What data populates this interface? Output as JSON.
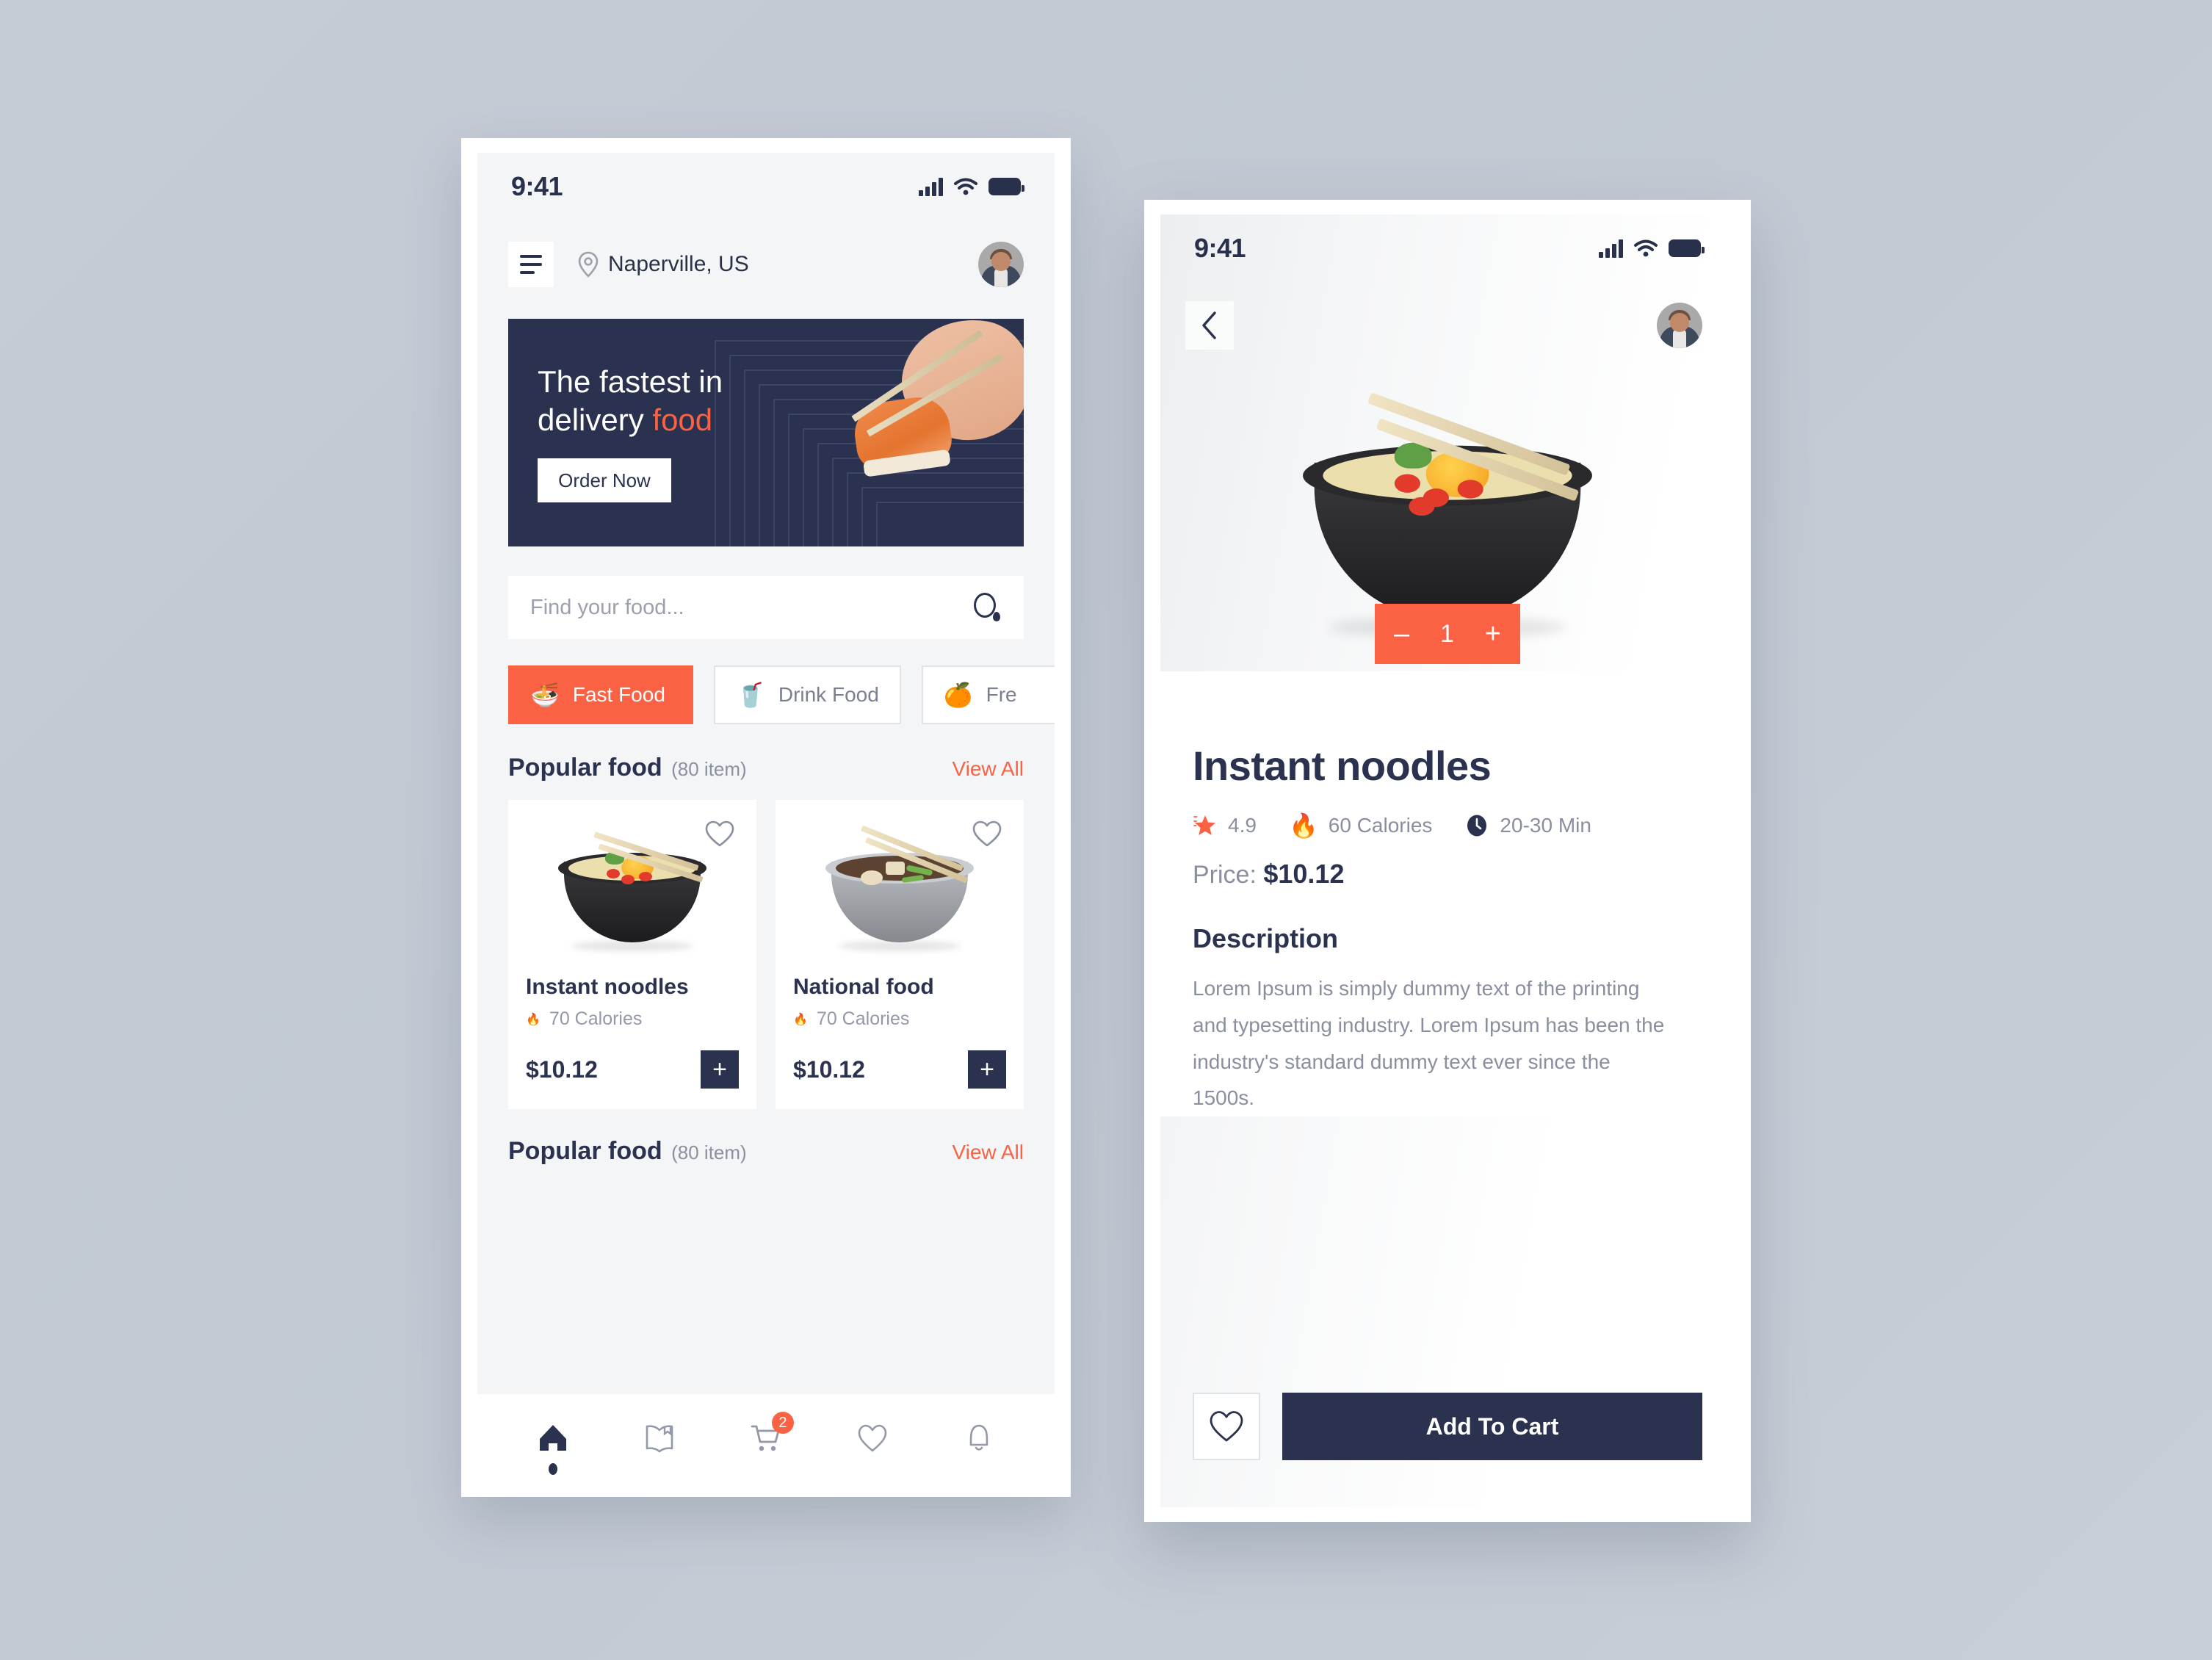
{
  "theme": {
    "accent": "#fb6244",
    "dark": "#2b3250",
    "muted": "#8a8fa0",
    "screen_bg": "#f4f5f7",
    "page_bg": "#c5ccd5"
  },
  "home": {
    "status": {
      "time": "9:41",
      "signal_icon": "cellular-signal-icon",
      "wifi_icon": "wifi-icon",
      "battery_icon": "battery-icon"
    },
    "header": {
      "menu_icon": "hamburger-menu-icon",
      "location_icon": "location-pin-icon",
      "location": "Naperville, US",
      "avatar": "user-avatar"
    },
    "banner": {
      "title_line1": "The fastest in",
      "title_line2": "delivery ",
      "title_highlight": "food",
      "cta": "Order Now"
    },
    "search": {
      "placeholder": "Find your food...",
      "value": "",
      "icon": "search-icon"
    },
    "categories": [
      {
        "label": "Fast Food",
        "emoji": "🍜",
        "active": true
      },
      {
        "label": "Drink Food",
        "emoji": "🥤",
        "active": false
      },
      {
        "label": "Fre",
        "emoji": "🍊",
        "active": false
      }
    ],
    "section": {
      "title": "Popular food",
      "count": "(80 item)",
      "view_all": "View All"
    },
    "section2": {
      "title": "Popular food",
      "count": "(80 item)",
      "view_all": "View All"
    },
    "cards": [
      {
        "name": "Instant noodles",
        "calories": "70 Calories",
        "price": "$10.12",
        "add_label": "+",
        "fav_icon": "heart-outline-icon",
        "image": "instant-noodles-bowl"
      },
      {
        "name": "National food",
        "calories": "70 Calories",
        "price": "$10.12",
        "add_label": "+",
        "fav_icon": "heart-outline-icon",
        "image": "national-food-soup-bowl"
      }
    ],
    "bottom_nav": [
      {
        "icon": "home-icon",
        "active": true,
        "badge": ""
      },
      {
        "icon": "book-icon",
        "active": false,
        "badge": ""
      },
      {
        "icon": "cart-icon",
        "active": false,
        "badge": "2"
      },
      {
        "icon": "heart-icon",
        "active": false,
        "badge": ""
      },
      {
        "icon": "bell-icon",
        "active": false,
        "badge": ""
      }
    ]
  },
  "detail": {
    "status": {
      "time": "9:41",
      "signal_icon": "cellular-signal-icon",
      "wifi_icon": "wifi-icon",
      "battery_icon": "battery-icon"
    },
    "header": {
      "back_icon": "chevron-left-icon",
      "avatar": "user-avatar"
    },
    "hero_image": "instant-noodles-bowl-large",
    "stepper": {
      "minus": "–",
      "qty": "1",
      "plus": "+"
    },
    "title": "Instant noodles",
    "meta": [
      {
        "icon": "star-icon",
        "text": "4.9"
      },
      {
        "icon": "flame-icon",
        "text": "60 Calories"
      },
      {
        "icon": "clock-icon",
        "text": "20-30 Min"
      }
    ],
    "price_label": "Price: ",
    "price_value": "$10.12",
    "description_title": "Description",
    "description_text": "Lorem Ipsum is simply dummy text of the printing and typesetting industry. Lorem Ipsum has been the industry's standard dummy text ever since the 1500s.",
    "fav_icon": "heart-outline-icon",
    "add_to_cart": "Add To Cart"
  }
}
